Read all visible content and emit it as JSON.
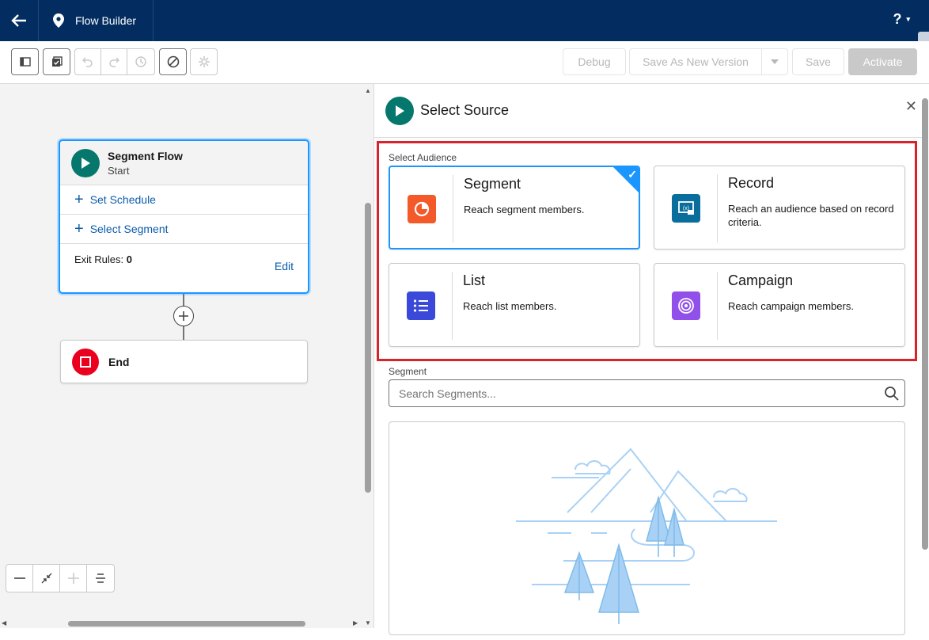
{
  "header": {
    "back_icon": "arrow-left-icon",
    "app_icon": "location-pin-icon",
    "app_title": "Flow Builder",
    "help_label": "?",
    "help_caret": "▾"
  },
  "toolbar": {
    "debug_label": "Debug",
    "save_as_new_version_label": "Save As New Version",
    "save_label": "Save",
    "activate_label": "Activate"
  },
  "canvas": {
    "start_node": {
      "title": "Segment Flow",
      "subtitle": "Start",
      "set_schedule_label": "Set Schedule",
      "select_segment_label": "Select Segment",
      "exit_rules_label": "Exit Rules:",
      "exit_rules_value": "0",
      "edit_label": "Edit"
    },
    "end_node": {
      "label": "End"
    }
  },
  "panel": {
    "title": "Select Source",
    "select_audience_label": "Select Audience",
    "tiles": [
      {
        "title": "Segment",
        "description": "Reach segment members.",
        "icon": "segment-pie-icon",
        "color": "#f4592a",
        "selected": true
      },
      {
        "title": "Record",
        "description": "Reach an audience based on record criteria.",
        "icon": "record-variable-icon",
        "color": "#066afe",
        "selected": false
      },
      {
        "title": "List",
        "description": "Reach list members.",
        "icon": "list-icon",
        "color": "#3a49da",
        "selected": false
      },
      {
        "title": "Campaign",
        "description": "Reach campaign members.",
        "icon": "target-icon",
        "color": "#9050e9",
        "selected": false
      }
    ],
    "segment_label": "Segment",
    "search_placeholder": "Search Segments..."
  },
  "colors": {
    "header_bg": "#032d60",
    "start_green": "#06776c",
    "end_red": "#ea001e",
    "link_blue": "#0b5cab",
    "selection_blue": "#1b96ff",
    "highlight_red": "#d8232a"
  }
}
